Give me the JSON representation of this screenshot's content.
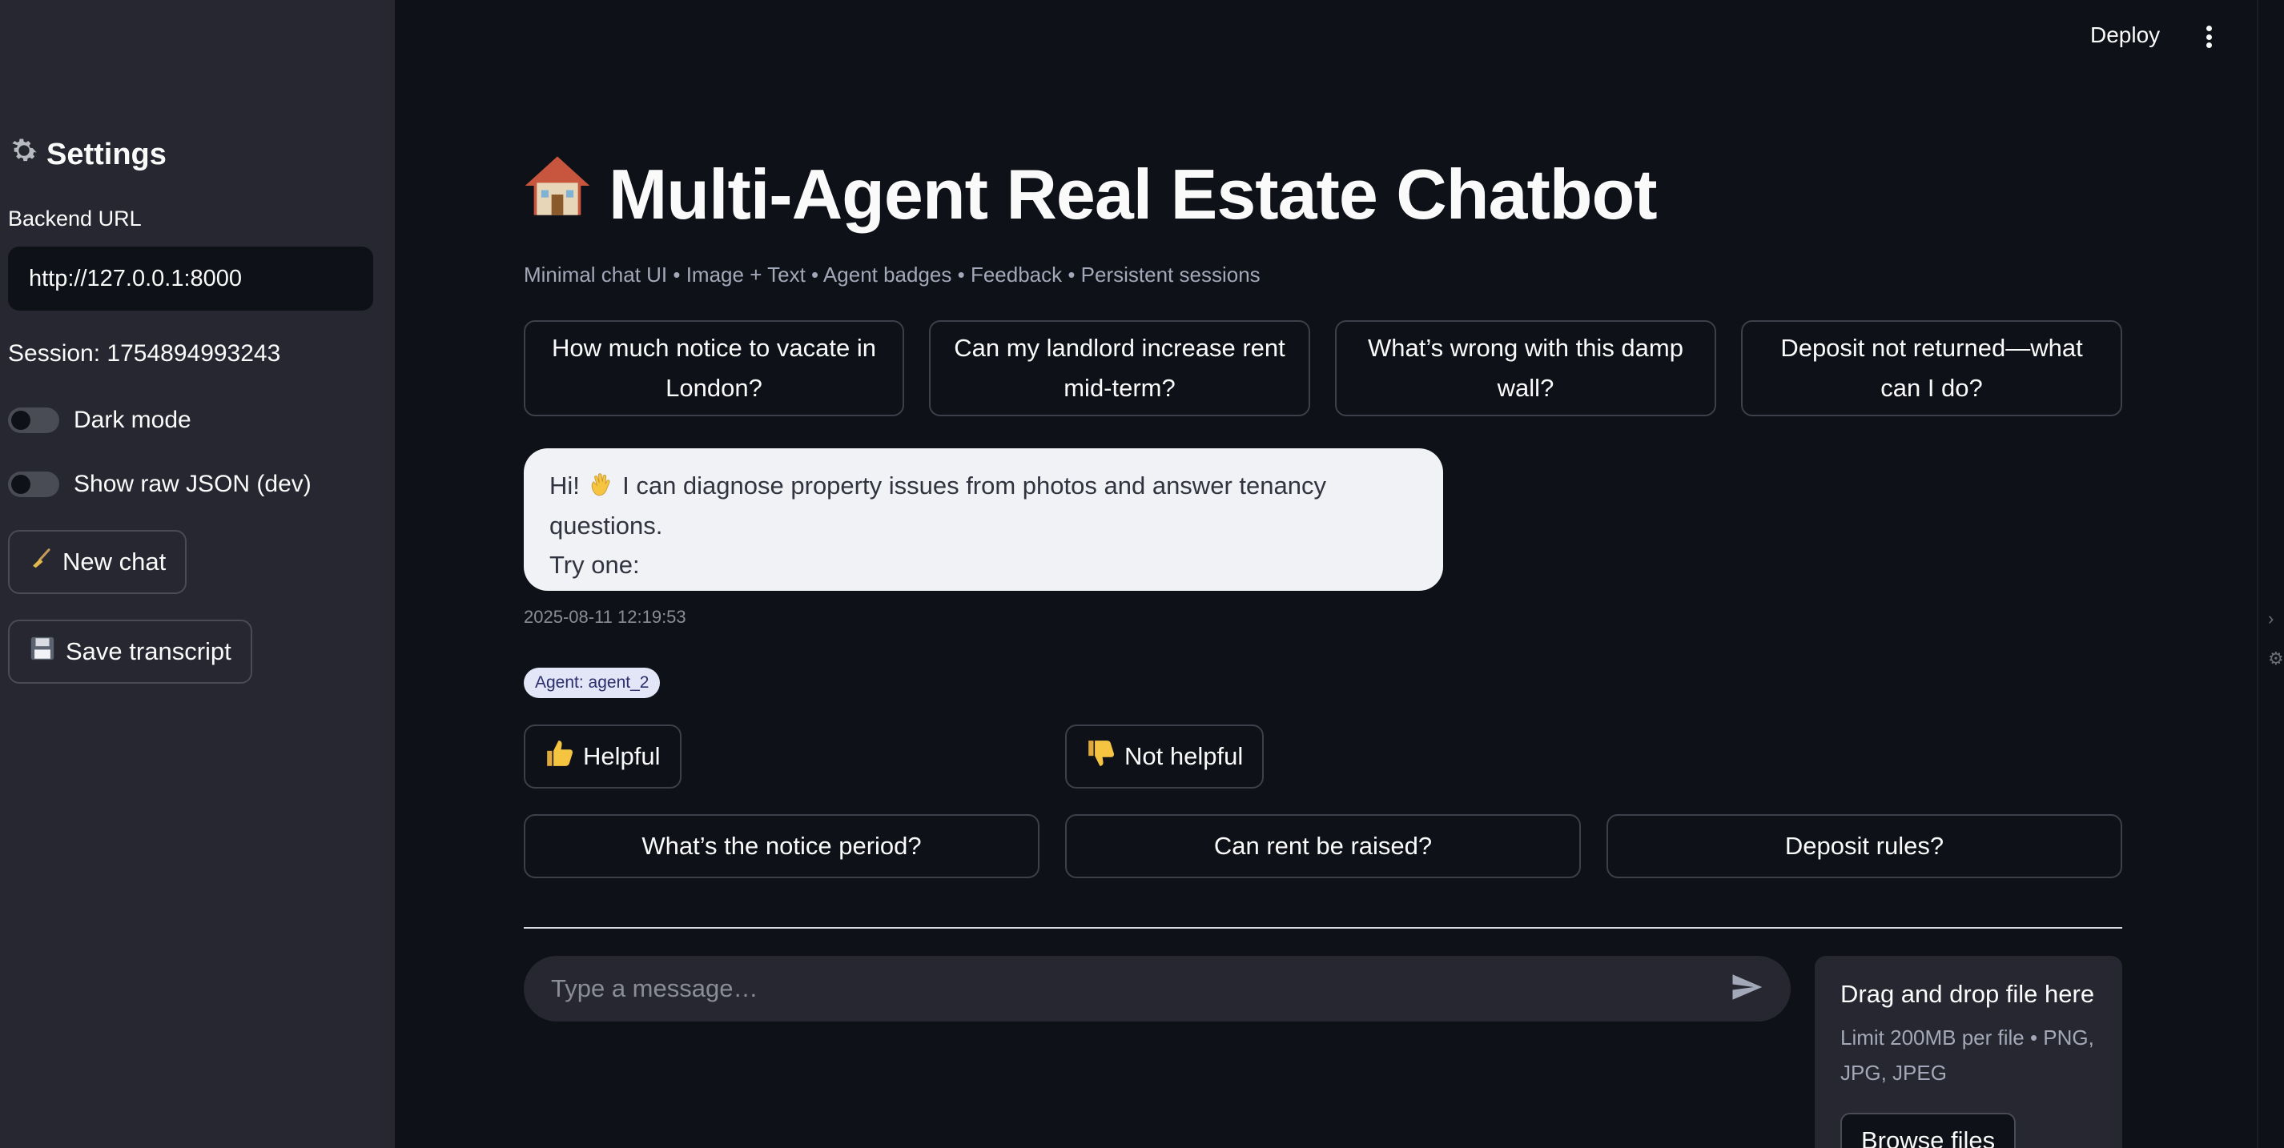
{
  "sidebar": {
    "title": "Settings",
    "title_icon": "gear-icon",
    "backend_label": "Backend URL",
    "backend_value": "http://127.0.0.1:8000",
    "session_text": "Session: 1754894993243",
    "dark_mode_label": "Dark mode",
    "raw_json_label": "Show raw JSON (dev)",
    "new_chat_label": "New chat",
    "new_chat_icon": "broom-icon",
    "save_transcript_label": "Save transcript",
    "save_transcript_icon": "floppy-disk-icon"
  },
  "header": {
    "deploy_label": "Deploy",
    "menu_icon": "kebab-menu-icon"
  },
  "main": {
    "title": "Multi-Agent Real Estate Chatbot",
    "title_icon": "house-icon",
    "subtitle": "Minimal chat UI • Image + Text • Agent badges • Feedback • Persistent sessions",
    "suggestions": [
      "How much notice to vacate in London?",
      "Can my landlord increase rent mid-term?",
      "What’s wrong with this damp wall?",
      "Deposit not returned—what can I do?"
    ],
    "message": {
      "text_before": "Hi! ",
      "wave_icon": "waving-hand-icon",
      "text_after": " I can diagnose property issues from photos and answer tenancy questions.",
      "text_line2": "Try one:",
      "timestamp": "2025-08-11 12:19:53",
      "agent_badge": "Agent: agent_2"
    },
    "feedback": {
      "helpful_label": "Helpful",
      "helpful_icon": "thumbs-up-icon",
      "not_helpful_label": "Not helpful",
      "not_helpful_icon": "thumbs-down-icon"
    },
    "quick_replies": [
      "What’s the notice period?",
      "Can rent be raised?",
      "Deposit rules?"
    ],
    "chat_input_placeholder": "Type a message…",
    "send_icon": "send-icon",
    "uploader": {
      "title": "Drag and drop file here",
      "limit": "Limit 200MB per file • PNG, JPG, JPEG",
      "browse_label": "Browse files"
    }
  }
}
